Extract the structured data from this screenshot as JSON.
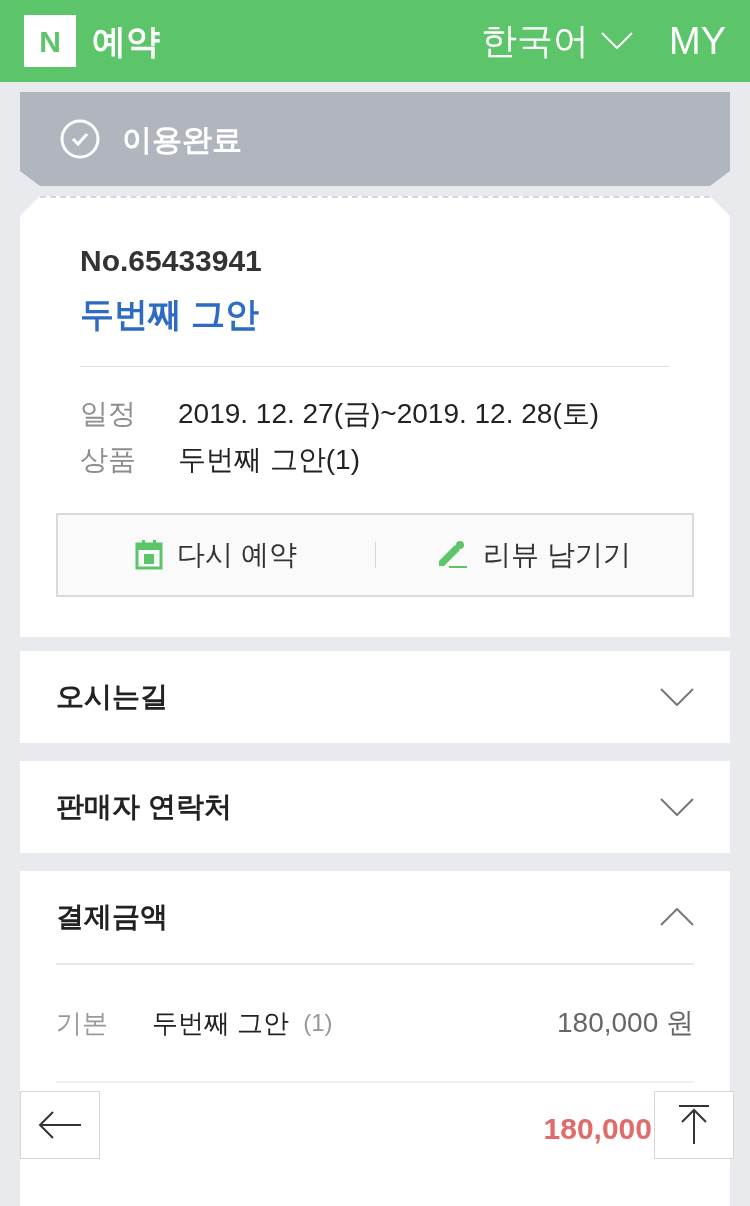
{
  "header": {
    "logo": "N",
    "title": "예약",
    "language": "한국어",
    "my": "MY"
  },
  "status": {
    "label": "이용완료"
  },
  "booking": {
    "number": "No.65433941",
    "name": "두번째 그안",
    "details": [
      {
        "label": "일정",
        "value": "2019. 12. 27(금)~2019. 12. 28(토)"
      },
      {
        "label": "상품",
        "value": "두번째 그안(1)"
      }
    ],
    "actions": [
      {
        "kind": "calendar",
        "label": "다시 예약"
      },
      {
        "kind": "pencil",
        "label": "리뷰 남기기"
      }
    ]
  },
  "sections": [
    {
      "title": "오시는길",
      "expanded": false
    },
    {
      "title": "판매자 연락처",
      "expanded": false
    },
    {
      "title": "결제금액",
      "expanded": true,
      "items": [
        {
          "type": "기본",
          "name": "두번째 그안",
          "qty": "(1)",
          "amount": "180,000 원"
        }
      ],
      "total": {
        "amount": "180,000"
      }
    }
  ]
}
